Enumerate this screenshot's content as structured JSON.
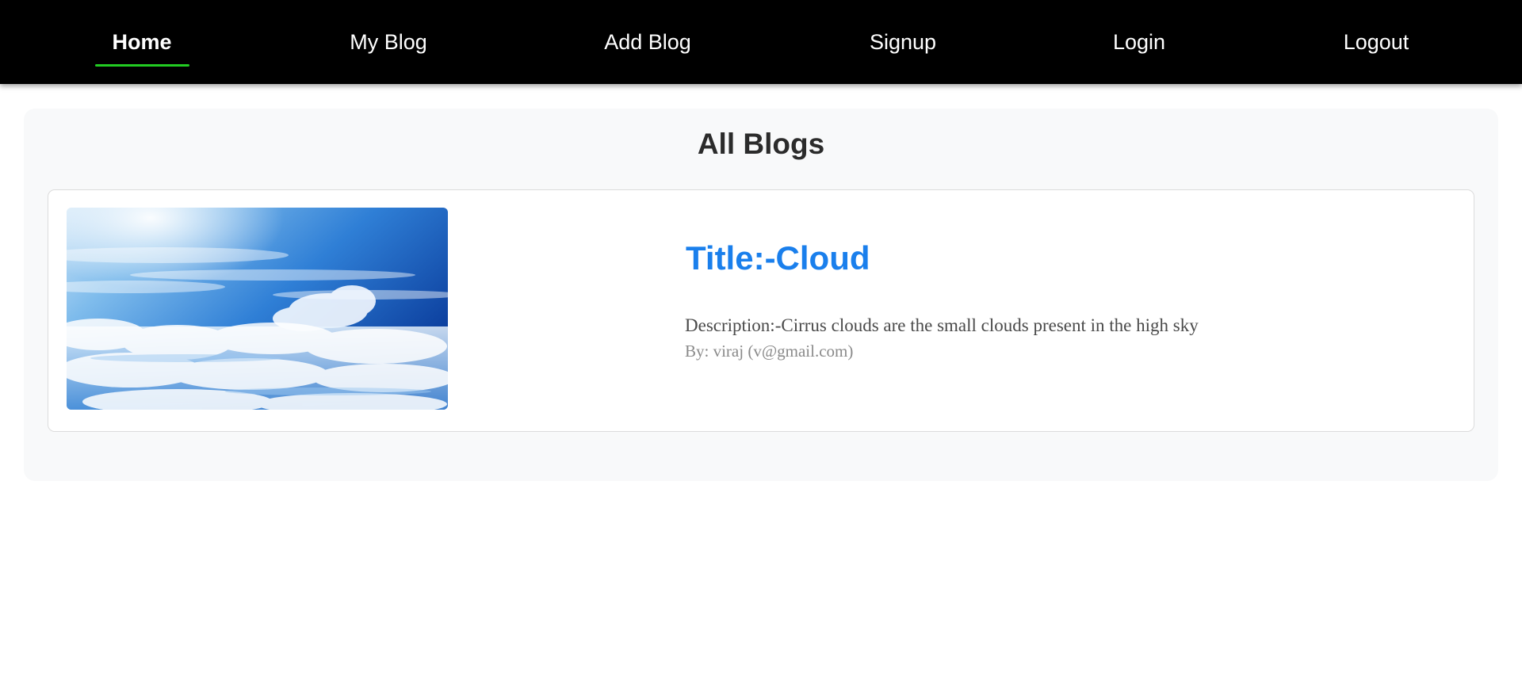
{
  "nav": {
    "items": [
      {
        "label": "Home",
        "active": true
      },
      {
        "label": "My Blog",
        "active": false
      },
      {
        "label": "Add Blog",
        "active": false
      },
      {
        "label": "Signup",
        "active": false
      },
      {
        "label": "Login",
        "active": false
      },
      {
        "label": "Logout",
        "active": false
      }
    ],
    "active_underline_color": "#22cc22",
    "background_color": "#000000"
  },
  "main": {
    "title": "All Blogs",
    "blogs": [
      {
        "image_subject": "sky-with-clouds",
        "title": "Title:-Cloud",
        "description": "Description:-Cirrus clouds are the small clouds present in the high sky",
        "author": "By: viraj (v@gmail.com)"
      }
    ]
  },
  "colors": {
    "title_blue": "#1a7fec",
    "container_bg": "#f8f9fa"
  }
}
